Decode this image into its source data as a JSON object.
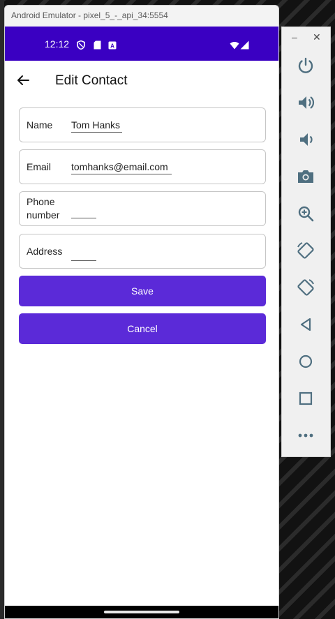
{
  "emulator": {
    "title": "Android Emulator - pixel_5_-_api_34:5554"
  },
  "status_bar": {
    "time": "12:12",
    "icons": [
      "shield-icon",
      "sd-card-icon",
      "a-notification-icon",
      "wifi-icon",
      "signal-icon"
    ]
  },
  "app_bar": {
    "title": "Edit Contact",
    "back_icon": "arrow-back-icon"
  },
  "form": {
    "name": {
      "label": "Name",
      "value": "Tom Hanks"
    },
    "email": {
      "label": "Email",
      "value": "tomhanks@email.com"
    },
    "phone": {
      "label": "Phone number",
      "value": ""
    },
    "address": {
      "label": "Address",
      "value": ""
    }
  },
  "buttons": {
    "save": "Save",
    "cancel": "Cancel"
  },
  "colors": {
    "status_bar": "#3a00c2",
    "button": "#5b2ad8",
    "side_icon": "#4f6f80"
  },
  "side_panel": {
    "minimize": "–",
    "close": "✕",
    "controls": [
      "power-icon",
      "volume-up-icon",
      "volume-down-icon",
      "camera-icon",
      "zoom-icon",
      "rotate-left-icon",
      "rotate-right-icon",
      "back-icon",
      "home-icon",
      "overview-icon",
      "more-icon"
    ]
  }
}
